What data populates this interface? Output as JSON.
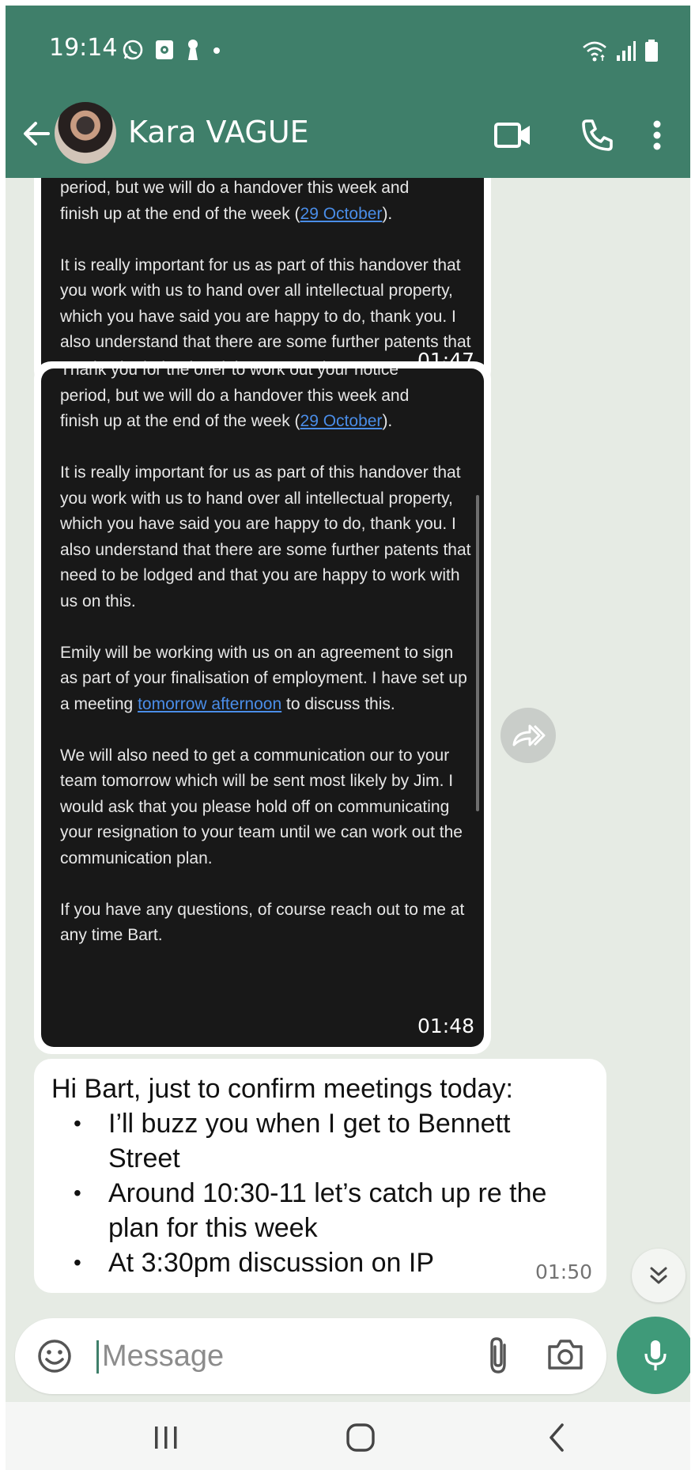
{
  "status_bar": {
    "time": "19:14",
    "left_icons": [
      "whatsapp-icon",
      "notification-icon",
      "keyhole-icon",
      "dot-icon"
    ],
    "right_icons": [
      "wifi-icon",
      "signal-icon",
      "battery-icon"
    ]
  },
  "header": {
    "contact_name": "Kara VAGUE",
    "actions": [
      "video-call-icon",
      "phone-icon",
      "more-icon"
    ]
  },
  "colors": {
    "header_bg": "#3f7f6a",
    "chat_bg": "#e6ebe4",
    "forward_bg": "#181818",
    "link": "#4a8de8",
    "mic_bg": "#3f9a79"
  },
  "messages": {
    "forward_1": {
      "p1_a": "period, but we will do a handover this week and",
      "p1_b": "finish up at the end of the week (",
      "p1_link": "29 October",
      "p1_end": ").",
      "p2": "It is really important for us as part of this handover that you work with us to hand over all intellectual property, which you have said you are happy to do, thank you. I also understand that there are some further patents that need to be lodged and that you are happy to work with us on this.",
      "time": "01:47"
    },
    "forward_2": {
      "partial_top": "Thank you for the offer to work out your notice",
      "p1_a": "period, but we will do a handover this week and",
      "p1_b": "finish up at the end of the week (",
      "p1_link": "29 October",
      "p1_end": ").",
      "p2": "It is really important for us as part of this handover that you work with us to hand over all intellectual property, which you have said you are happy to do, thank you. I also understand that there are some further patents that need to be lodged and that you are happy to work with us on this.",
      "p3_a": "Emily will be working with us on an agreement to sign as part of your finalisation of employment. I have set up a meeting ",
      "p3_link": "tomorrow afternoon",
      "p3_b": " to discuss this.",
      "p4": "We will also need to get a communication our to your team tomorrow which will be sent most likely by Jim. I would ask that you please hold off on communicating your resignation to your team until we can work out the communication plan.",
      "p5": "If you have any questions, of course reach out to me at any time Bart.",
      "time": "01:48"
    },
    "text_message": {
      "intro": "Hi Bart, just to confirm meetings today:",
      "items": [
        "I’ll buzz you when I get to Bennett Street",
        "Around 10:30-11 let’s catch up re the plan for this week",
        "At 3:30pm discussion on IP"
      ],
      "time": "01:50"
    }
  },
  "composer": {
    "placeholder": "Message",
    "icons": [
      "emoji-icon",
      "attach-icon",
      "camera-icon",
      "mic-icon"
    ]
  },
  "nav_bar": {
    "icons": [
      "recent-apps-icon",
      "home-icon",
      "back-icon"
    ]
  }
}
